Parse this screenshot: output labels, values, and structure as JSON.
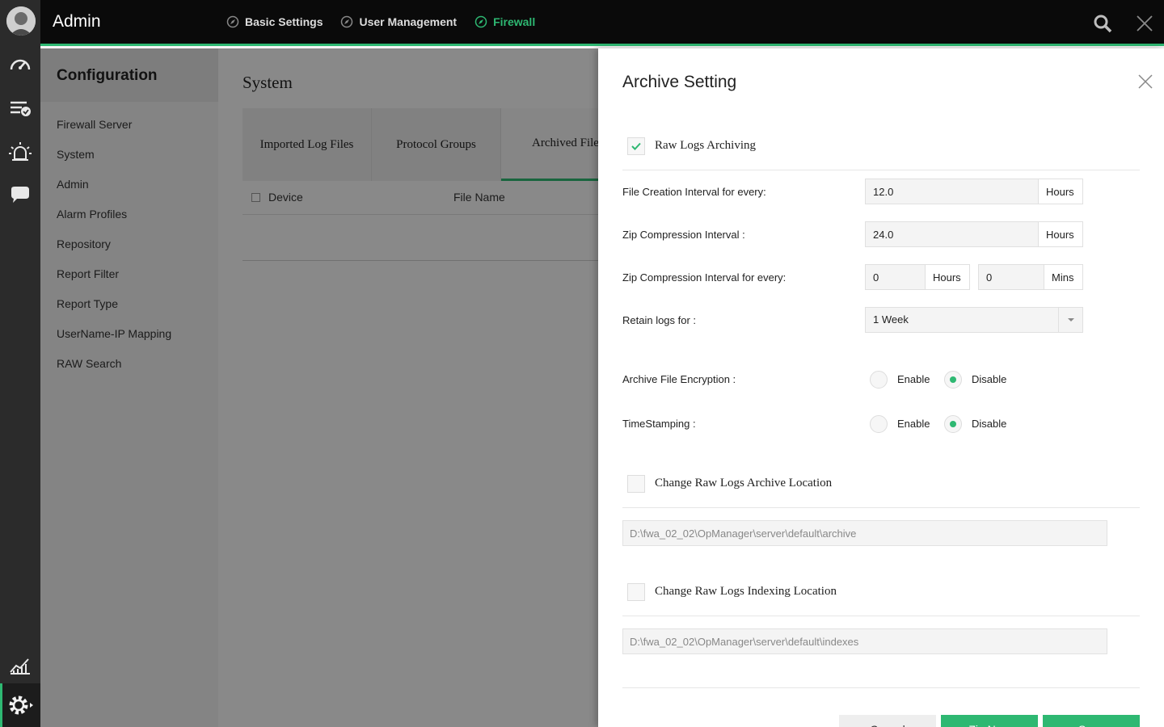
{
  "topbar": {
    "title": "Admin",
    "nav": [
      {
        "label": "Basic Settings",
        "icon": "compass-icon"
      },
      {
        "label": "User Management",
        "icon": "compass-icon"
      },
      {
        "label": "Firewall",
        "icon": "compass-icon"
      }
    ],
    "active_nav": "Firewall"
  },
  "rail": {
    "icons": [
      "avatar",
      "dashboard-gauge-icon",
      "reports-list-icon",
      "alarm-icon",
      "chat-icon",
      "analytics-chart-icon",
      "settings-gear-icon"
    ],
    "active": "settings-gear-icon"
  },
  "config": {
    "title": "Configuration",
    "items": [
      "Firewall Server",
      "System",
      "Admin",
      "Alarm Profiles",
      "Repository",
      "Report Filter",
      "Report Type",
      "UserName-IP Mapping",
      "RAW Search"
    ]
  },
  "main": {
    "title": "System",
    "tabs": [
      "Imported Log Files",
      "Protocol Groups",
      "Archived File"
    ],
    "active_tab": "Archived File",
    "columns": [
      "Device",
      "File Name"
    ]
  },
  "panel": {
    "title": "Archive Setting",
    "raw_logs_archiving": {
      "label": "Raw Logs Archiving",
      "checked": true
    },
    "file_creation": {
      "label": "File Creation Interval for every:",
      "value": "12.0",
      "unit": "Hours"
    },
    "zip_interval": {
      "label": "Zip Compression Interval :",
      "value": "24.0",
      "unit": "Hours"
    },
    "zip_every": {
      "label": "Zip Compression Interval for every:",
      "hours_value": "0",
      "hours_unit": "Hours",
      "mins_value": "0",
      "mins_unit": "Mins"
    },
    "retain": {
      "label": "Retain logs for :",
      "value": "1 Week"
    },
    "encryption": {
      "label": "Archive File Encryption :",
      "enable": "Enable",
      "disable": "Disable",
      "selected": "Disable"
    },
    "timestamping": {
      "label": "TimeStamping :",
      "enable": "Enable",
      "disable": "Disable",
      "selected": "Disable"
    },
    "archive_location": {
      "label": "Change Raw Logs Archive Location",
      "checked": false,
      "path": "D:\\fwa_02_02\\OpManager\\server\\default\\archive"
    },
    "index_location": {
      "label": "Change Raw Logs Indexing Location",
      "checked": false,
      "path": "D:\\fwa_02_02\\OpManager\\server\\default\\indexes"
    },
    "buttons": {
      "cancel": "Cancel",
      "zip_now": "Zip Now",
      "save": "Save"
    }
  },
  "colors": {
    "accent": "#2eb872",
    "topbar": "#0a0a0a",
    "rail": "#2b2b2b"
  }
}
